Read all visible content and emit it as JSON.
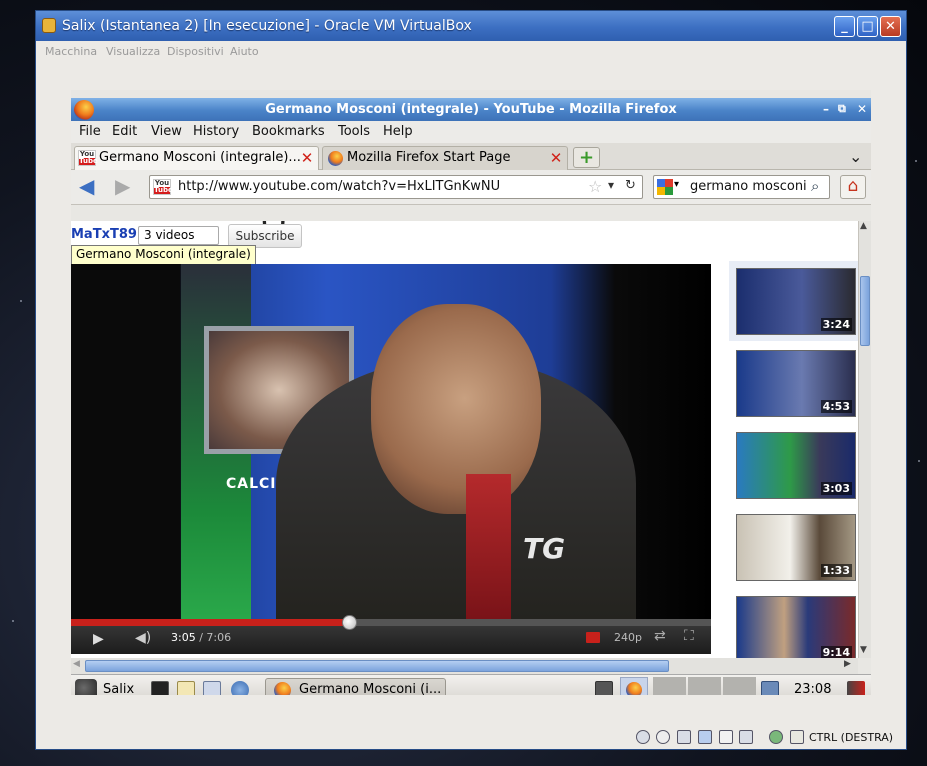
{
  "vbox": {
    "title": "Salix (Istantanea 2) [In esecuzione] - Oracle VM VirtualBox",
    "menu": [
      "Macchina",
      "Visualizza",
      "Dispositivi",
      "Aiuto"
    ],
    "host_key": "CTRL (DESTRA)",
    "minimize": "_",
    "maximize": "□",
    "close": "✕"
  },
  "firefox": {
    "title": "Germano Mosconi (integrale) - YouTube - Mozilla Firefox",
    "menu": [
      "File",
      "Edit",
      "View",
      "History",
      "Bookmarks",
      "Tools",
      "Help"
    ],
    "tabs": [
      {
        "label": "Germano Mosconi (integrale)...",
        "active": true
      },
      {
        "label": "Mozilla Firefox Start Page",
        "active": false
      }
    ],
    "new_tab": "+",
    "tab_list": "⌄",
    "url": "http://www.youtube.com/watch?v=HxLITGnKwNU",
    "search": "germano mosconi"
  },
  "youtube": {
    "title_partial": "(          )",
    "channel": "MaTxT89",
    "videos_count": "3 videos",
    "subscribe_label": "Subscribe",
    "tooltip": "Germano Mosconi (integrale)",
    "time_current": "3:05",
    "time_total": "7:06",
    "time_sep": " / ",
    "quality": "240p",
    "progress": 0.434,
    "overlay_text": "CALCIO",
    "logo_text": "TG",
    "related": [
      "3:24",
      "4:53",
      "3:03",
      "1:33",
      "9:14"
    ]
  },
  "taskbar": {
    "start_label": "Salix",
    "window_label": "Germano Mosconi (i...",
    "clock": "23:08"
  },
  "colors": {
    "vbox_title": "#3c6fc2",
    "ff_title": "#4a83c8",
    "yt_red": "#c8211b",
    "tooltip_bg": "#ffffcc"
  }
}
